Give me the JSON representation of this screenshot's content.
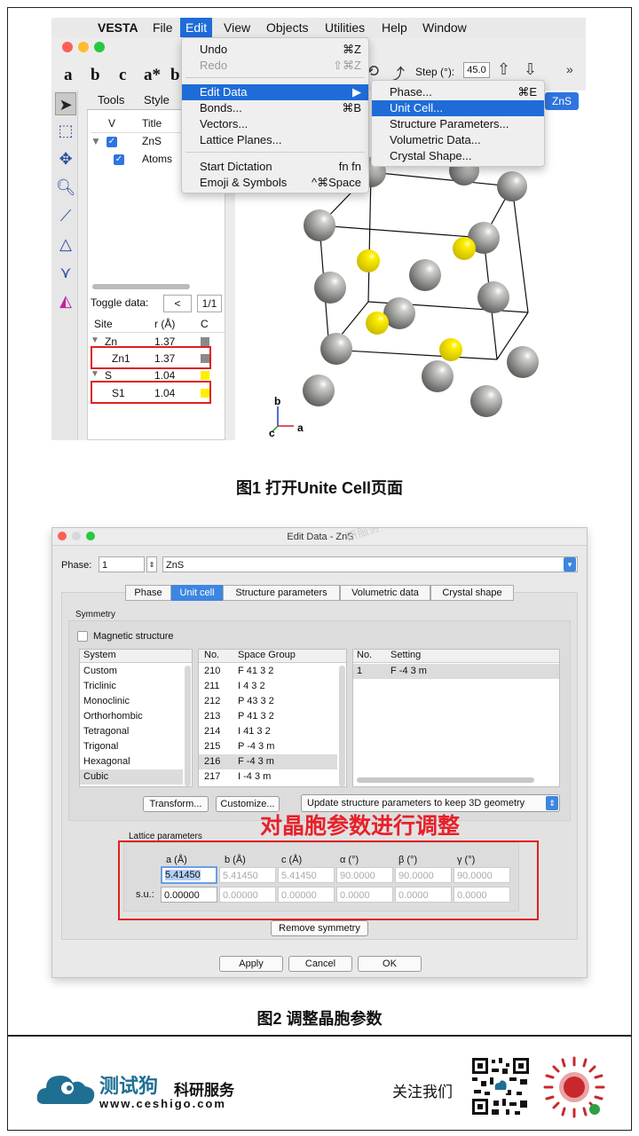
{
  "shot1": {
    "menubar": {
      "app": "VESTA",
      "items": [
        "File",
        "Edit",
        "View",
        "Objects",
        "Utilities",
        "Help",
        "Window"
      ]
    },
    "toolbar_letters": [
      "a",
      "b",
      "c",
      "a*",
      "b"
    ],
    "step": {
      "label": "Step (°):",
      "value": "45.0"
    },
    "tabs": [
      "Tools",
      "Style"
    ],
    "tree": {
      "headers": [
        "V",
        "Title"
      ],
      "rows": [
        "ZnS",
        "Atoms"
      ]
    },
    "toggle": {
      "label": "Toggle data:",
      "prev": "<",
      "page": "1/1"
    },
    "sites": {
      "headers": [
        "Site",
        "r (Å)",
        "C"
      ],
      "rows": [
        {
          "site": "Zn",
          "r": "1.37",
          "color": "#8a8a8a"
        },
        {
          "site": "Zn1",
          "r": "1.37",
          "color": "#8a8a8a"
        },
        {
          "site": "S",
          "r": "1.04",
          "color": "#ffee00"
        },
        {
          "site": "S1",
          "r": "1.04",
          "color": "#ffee00"
        }
      ]
    },
    "edit_menu": [
      {
        "label": "Undo",
        "shortcut": "⌘Z"
      },
      {
        "label": "Redo",
        "shortcut": "⇧⌘Z"
      },
      {
        "label": "Edit Data",
        "shortcut": "▶"
      },
      {
        "label": "Bonds...",
        "shortcut": "⌘B"
      },
      {
        "label": "Vectors...",
        "shortcut": ""
      },
      {
        "label": "Lattice Planes...",
        "shortcut": ""
      },
      {
        "label": "Start Dictation",
        "shortcut": "fn fn"
      },
      {
        "label": "Emoji & Symbols",
        "shortcut": "^⌘Space"
      }
    ],
    "submenu": [
      {
        "label": "Phase...",
        "shortcut": "⌘E"
      },
      {
        "label": "Unit Cell...",
        "shortcut": ""
      },
      {
        "label": "Structure Parameters...",
        "shortcut": ""
      },
      {
        "label": "Volumetric Data...",
        "shortcut": ""
      },
      {
        "label": "Crystal Shape...",
        "shortcut": ""
      }
    ],
    "phase_button": "ZnS",
    "axes": {
      "a": "a",
      "b": "b",
      "c": "c"
    },
    "atom_colors": {
      "zn": "#7d7d7a",
      "s": "#ffee00"
    }
  },
  "caption1": "图1 打开Unite Cell页面",
  "shot2": {
    "title": "Edit Data - ZnS",
    "watermark": "研服务",
    "phase_label": "Phase:",
    "phase_value": "1",
    "phase_name": "ZnS",
    "tabs": [
      "Phase",
      "Unit cell",
      "Structure parameters",
      "Volumetric data",
      "Crystal shape"
    ],
    "symmetry_label": "Symmetry",
    "magnetic_label": "Magnetic structure",
    "system_header": "System",
    "systems": [
      "Custom",
      "Triclinic",
      "Monoclinic",
      "Orthorhombic",
      "Tetragonal",
      "Trigonal",
      "Hexagonal",
      "Cubic"
    ],
    "sg_headers": [
      "No.",
      "Space Group"
    ],
    "space_groups": [
      {
        "no": "210",
        "sg": "F 41 3 2"
      },
      {
        "no": "211",
        "sg": "I 4 3 2"
      },
      {
        "no": "212",
        "sg": "P 43 3 2"
      },
      {
        "no": "213",
        "sg": "P 41 3 2"
      },
      {
        "no": "214",
        "sg": "I 41 3 2"
      },
      {
        "no": "215",
        "sg": "P -4 3 m"
      },
      {
        "no": "216",
        "sg": "F -4 3 m"
      },
      {
        "no": "217",
        "sg": "I -4 3 m"
      }
    ],
    "setting_headers": [
      "No.",
      "Setting"
    ],
    "settings": [
      {
        "no": "1",
        "setting": "F -4 3 m"
      }
    ],
    "transform_btn": "Transform...",
    "customize_btn": "Customize...",
    "update_select": "Update structure parameters to keep 3D geometry",
    "annotation": "对晶胞参数进行调整",
    "lattice_label": "Lattice parameters",
    "lattice_headers": [
      "a (Å)",
      "b (Å)",
      "c (Å)",
      "α (°)",
      "β (°)",
      "γ (°)"
    ],
    "lattice_values": [
      "5.41450",
      "5.41450",
      "5.41450",
      "90.0000",
      "90.0000",
      "90.0000"
    ],
    "su_label": "s.u.:",
    "su_values": [
      "0.00000",
      "0.00000",
      "0.00000",
      "0.0000",
      "0.0000",
      "0.0000"
    ],
    "remove_btn": "Remove symmetry",
    "apply_btn": "Apply",
    "cancel_btn": "Cancel",
    "ok_btn": "OK"
  },
  "caption2": "图2 调整晶胞参数",
  "footer": {
    "brand": "测试狗",
    "brand_sub": "科研服务",
    "url": "www.ceshigo.com",
    "follow": "关注我们",
    "brand_color": "#1f6f93"
  }
}
